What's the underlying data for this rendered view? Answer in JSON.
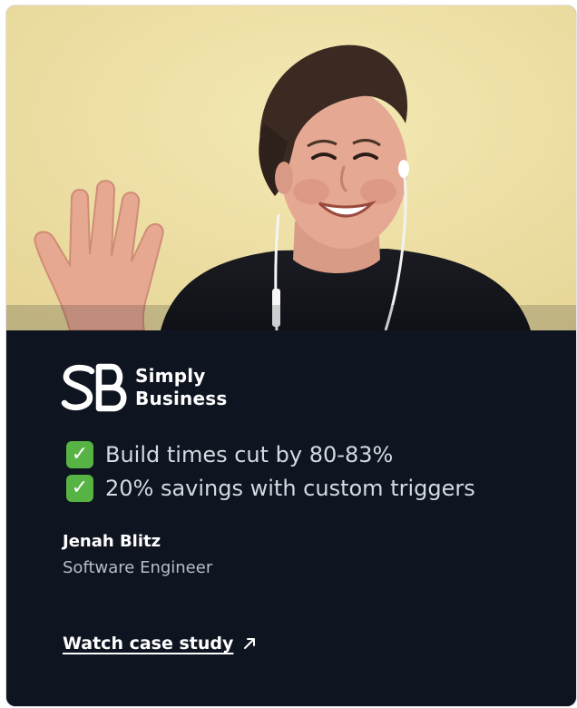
{
  "card": {
    "brand": {
      "mark": "SB",
      "line1": "Simply",
      "line2": "Business"
    },
    "highlights": [
      {
        "icon": "check-mark-icon",
        "text": "Build times cut by 80-83%"
      },
      {
        "icon": "check-mark-icon",
        "text": "20% savings with custom triggers"
      }
    ],
    "person": {
      "name": "Jenah Blitz",
      "role": "Software Engineer"
    },
    "cta": {
      "label": "Watch case study",
      "icon": "arrow-up-right-icon"
    }
  },
  "colors": {
    "card_background": "#0e1420",
    "photo_wall": "#ede2a8",
    "check_green": "#56b344",
    "text_primary": "#ffffff",
    "text_secondary": "#b9bfc9"
  }
}
